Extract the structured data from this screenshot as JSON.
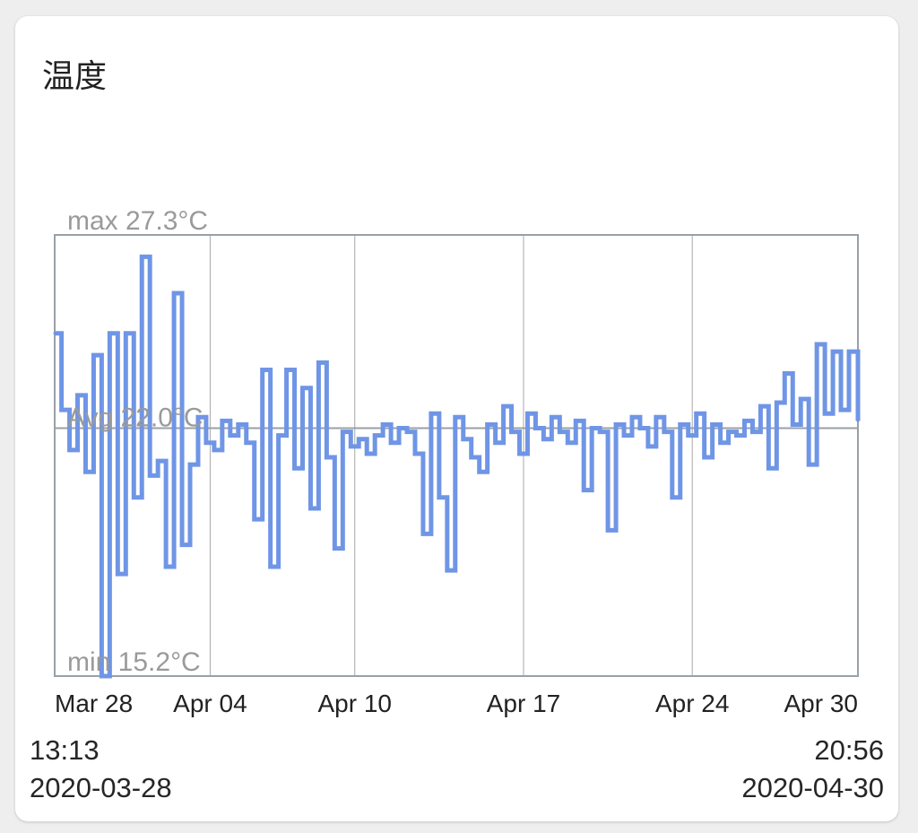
{
  "card": {
    "title": "温度"
  },
  "footer": {
    "start_time": "13:13",
    "start_date": "2020-03-28",
    "end_time": "20:56",
    "end_date": "2020-04-30"
  },
  "colors": {
    "line": "#6f95e6",
    "axis": "#9aa0a8",
    "grid": "#a8a8a8",
    "label": "#9a9a9a"
  },
  "chart_data": {
    "type": "line",
    "title": "温度",
    "xlabel": "",
    "ylabel": "",
    "ylim": [
      15.2,
      27.3
    ],
    "x_tick_labels": [
      "Mar 28",
      "Apr 04",
      "Apr 10",
      "Apr 17",
      "Apr 24",
      "Apr 30"
    ],
    "x_tick_dates": [
      "2020-03-28T13:13",
      "2020-04-04T00:00",
      "2020-04-10T00:00",
      "2020-04-17T00:00",
      "2020-04-24T00:00",
      "2020-04-30T20:56"
    ],
    "max_label": "max 27.3°C",
    "min_label": "min 15.2°C",
    "avg_label": "Avg 22.0°C",
    "avg_value": 22.0,
    "grid": true,
    "series": [
      {
        "x": [
          "2020-03-28T13:13",
          "2020-03-28T20:00",
          "2020-03-29T04:00",
          "2020-03-29T12:00",
          "2020-03-29T20:00",
          "2020-03-30T04:00",
          "2020-03-30T12:00",
          "2020-03-30T20:00",
          "2020-03-31T04:00",
          "2020-03-31T12:00",
          "2020-03-31T20:00",
          "2020-04-01T04:00",
          "2020-04-01T12:00",
          "2020-04-01T20:00",
          "2020-04-02T04:00",
          "2020-04-02T12:00",
          "2020-04-02T20:00",
          "2020-04-03T04:00",
          "2020-04-03T12:00",
          "2020-04-03T20:00",
          "2020-04-04T04:00",
          "2020-04-04T12:00",
          "2020-04-04T20:00",
          "2020-04-05T04:00",
          "2020-04-05T12:00",
          "2020-04-05T20:00",
          "2020-04-06T04:00",
          "2020-04-06T12:00",
          "2020-04-06T20:00",
          "2020-04-07T04:00",
          "2020-04-07T12:00",
          "2020-04-07T20:00",
          "2020-04-08T04:00",
          "2020-04-08T12:00",
          "2020-04-08T20:00",
          "2020-04-09T04:00",
          "2020-04-09T12:00",
          "2020-04-09T20:00",
          "2020-04-10T04:00",
          "2020-04-10T12:00",
          "2020-04-10T20:00",
          "2020-04-11T04:00",
          "2020-04-11T12:00",
          "2020-04-11T20:00",
          "2020-04-12T04:00",
          "2020-04-12T12:00",
          "2020-04-12T20:00",
          "2020-04-13T04:00",
          "2020-04-13T12:00",
          "2020-04-13T20:00",
          "2020-04-14T04:00",
          "2020-04-14T12:00",
          "2020-04-14T20:00",
          "2020-04-15T04:00",
          "2020-04-15T12:00",
          "2020-04-15T20:00",
          "2020-04-16T04:00",
          "2020-04-16T12:00",
          "2020-04-16T20:00",
          "2020-04-17T04:00",
          "2020-04-17T12:00",
          "2020-04-17T20:00",
          "2020-04-18T04:00",
          "2020-04-18T12:00",
          "2020-04-18T20:00",
          "2020-04-19T04:00",
          "2020-04-19T12:00",
          "2020-04-19T20:00",
          "2020-04-20T04:00",
          "2020-04-20T12:00",
          "2020-04-20T20:00",
          "2020-04-21T04:00",
          "2020-04-21T12:00",
          "2020-04-21T20:00",
          "2020-04-22T04:00",
          "2020-04-22T12:00",
          "2020-04-22T20:00",
          "2020-04-23T04:00",
          "2020-04-23T12:00",
          "2020-04-23T20:00",
          "2020-04-24T04:00",
          "2020-04-24T12:00",
          "2020-04-24T20:00",
          "2020-04-25T04:00",
          "2020-04-25T12:00",
          "2020-04-25T20:00",
          "2020-04-26T04:00",
          "2020-04-26T12:00",
          "2020-04-26T20:00",
          "2020-04-27T04:00",
          "2020-04-27T12:00",
          "2020-04-27T20:00",
          "2020-04-28T04:00",
          "2020-04-28T12:00",
          "2020-04-28T20:00",
          "2020-04-29T04:00",
          "2020-04-29T12:00",
          "2020-04-29T20:00",
          "2020-04-30T04:00",
          "2020-04-30T12:00",
          "2020-04-30T20:56"
        ],
        "y": [
          24.6,
          22.5,
          21.4,
          22.9,
          20.8,
          24.0,
          15.2,
          24.6,
          18.0,
          24.6,
          20.1,
          26.7,
          20.7,
          21.1,
          18.2,
          25.7,
          18.8,
          21.0,
          22.3,
          21.6,
          21.4,
          22.2,
          21.8,
          22.1,
          21.6,
          19.5,
          23.6,
          18.2,
          21.8,
          23.6,
          20.9,
          23.1,
          19.8,
          23.8,
          21.2,
          18.7,
          21.9,
          21.5,
          21.7,
          21.3,
          21.8,
          22.1,
          21.6,
          22.0,
          21.9,
          21.3,
          19.1,
          22.4,
          20.1,
          18.1,
          22.3,
          21.7,
          21.2,
          20.8,
          22.1,
          21.6,
          22.6,
          21.9,
          21.3,
          22.4,
          22.0,
          21.7,
          22.3,
          21.9,
          21.6,
          22.2,
          20.3,
          22.0,
          21.9,
          19.2,
          22.1,
          21.8,
          22.3,
          22.0,
          21.5,
          22.3,
          21.9,
          20.1,
          22.1,
          21.8,
          22.4,
          21.2,
          22.1,
          21.6,
          21.9,
          21.8,
          22.2,
          21.9,
          22.6,
          20.9,
          22.7,
          23.5,
          22.1,
          22.8,
          21.0,
          24.3,
          22.4,
          24.1,
          22.5,
          24.1,
          22.2
        ]
      }
    ]
  }
}
